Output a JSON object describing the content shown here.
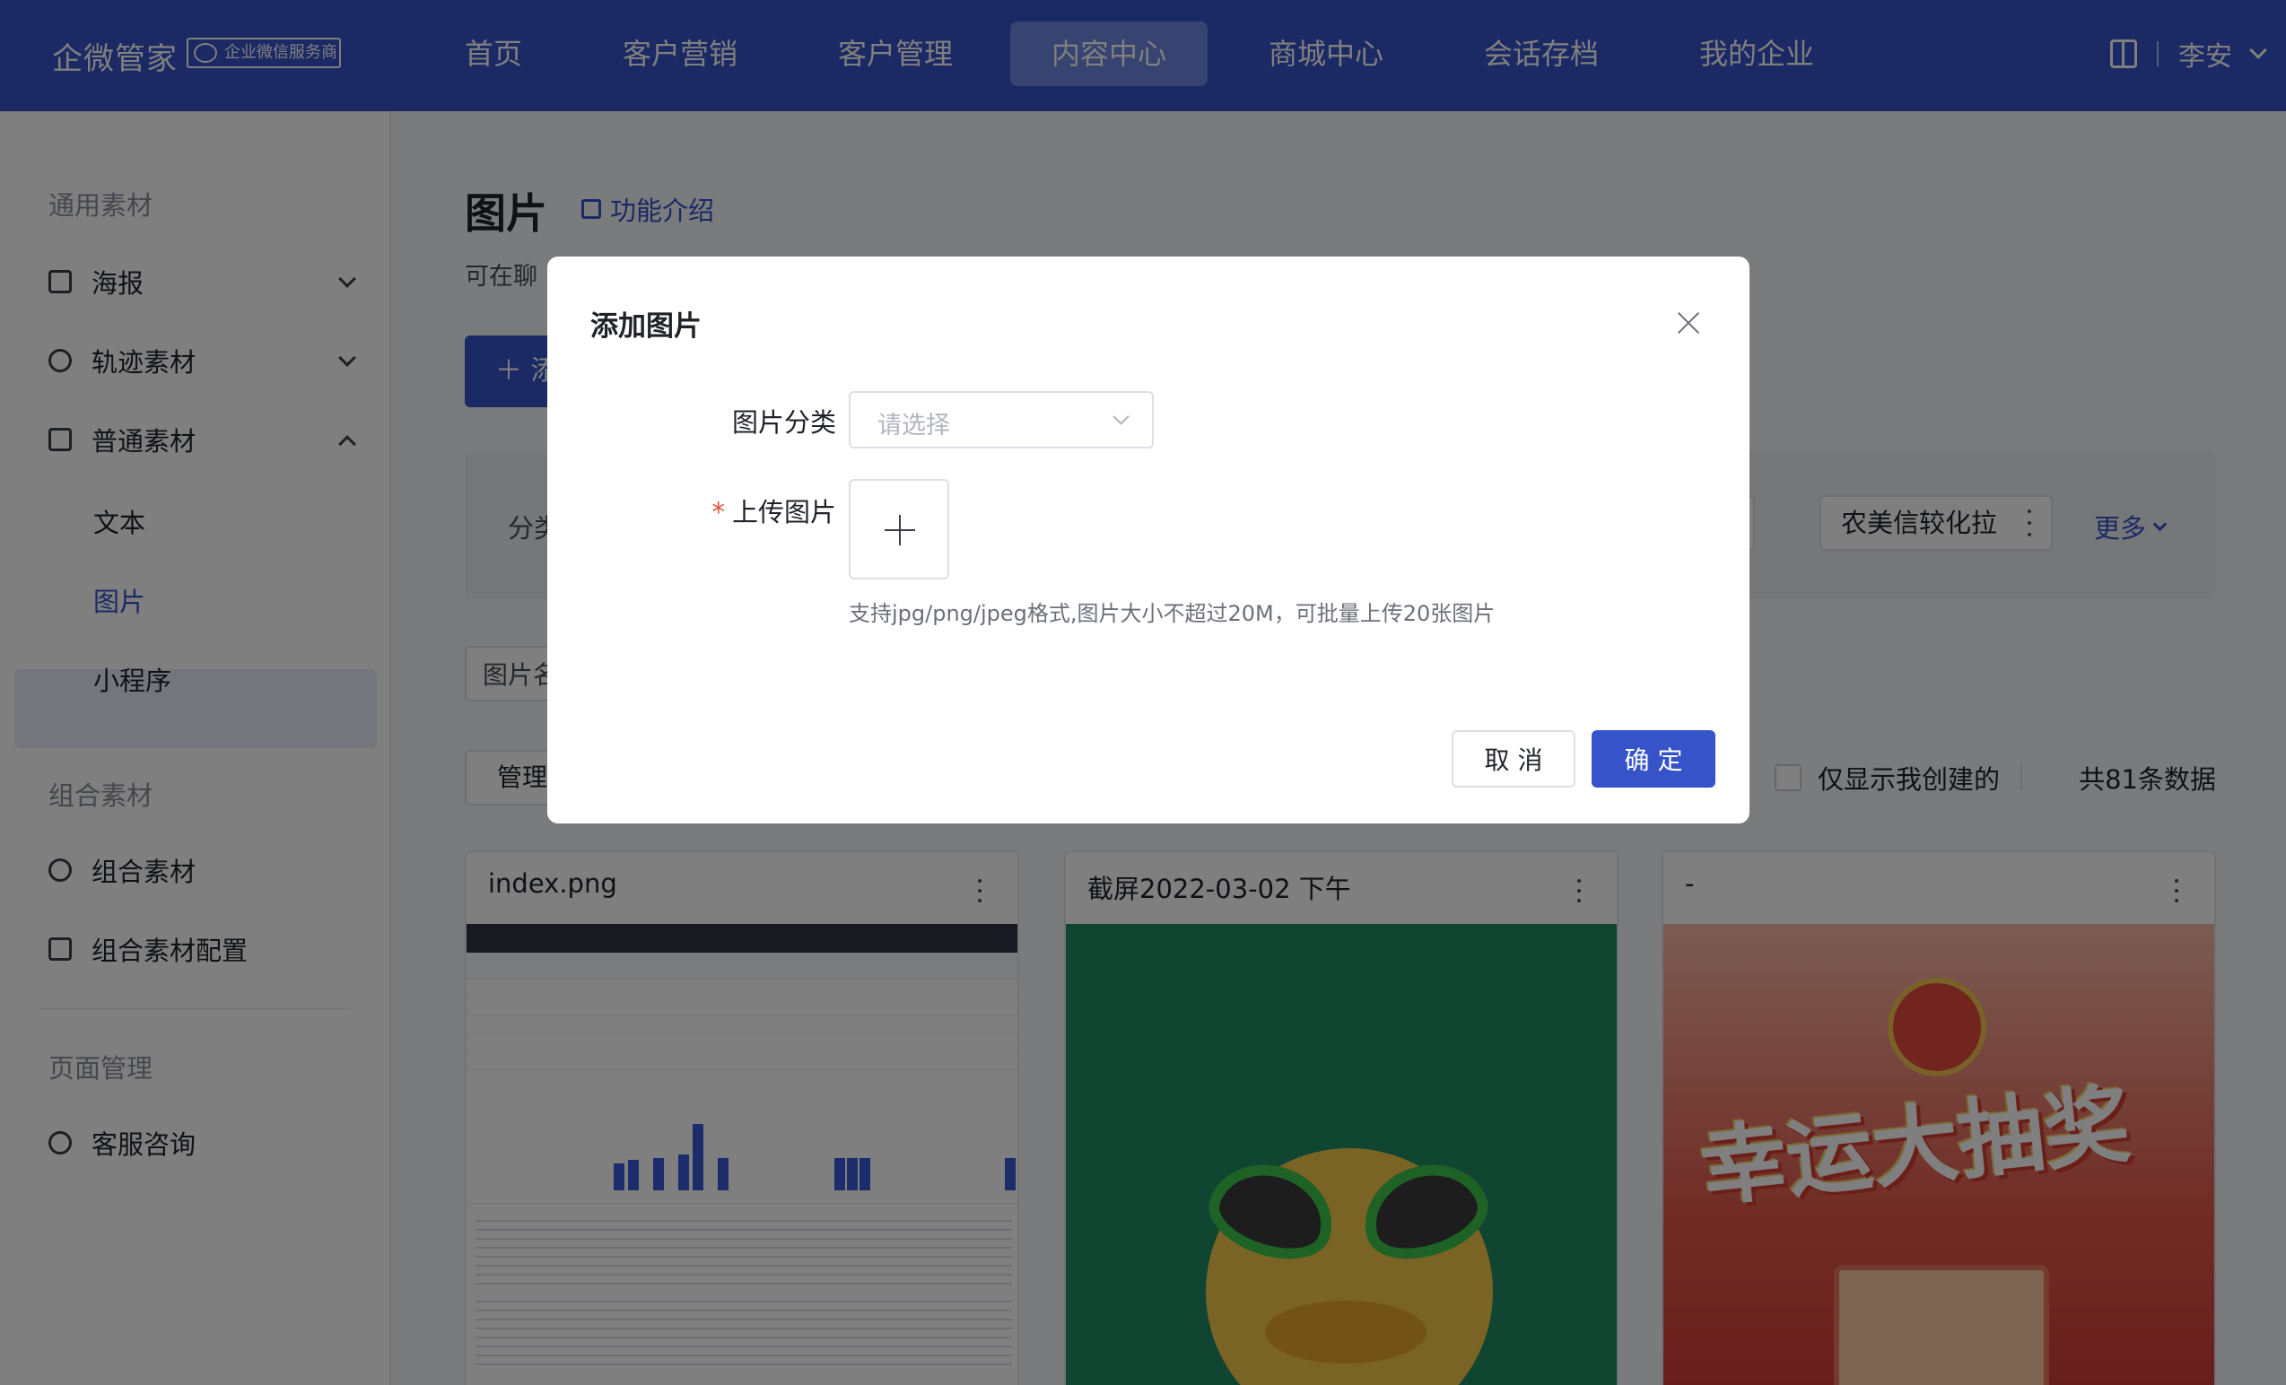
{
  "app": {
    "brand": "企微管家",
    "badge": "企业微信服务商"
  },
  "topnav": {
    "items": [
      "首页",
      "客户营销",
      "客户管理",
      "内容中心",
      "商城中心",
      "会话存档",
      "我的企业"
    ],
    "active": "内容中心",
    "user": "李安",
    "accent_color": "#3653c9"
  },
  "sidebar": {
    "group1": "通用素材",
    "poster": "海报",
    "track": "轨迹素材",
    "normal": "普通素材",
    "sub_text": "文本",
    "sub_image": "图片",
    "sub_miniapp": "小程序",
    "group2": "组合素材",
    "combo": "组合素材",
    "combo_config": "组合素材配置",
    "group3": "页面管理",
    "service": "客服咨询"
  },
  "main": {
    "title": "图片",
    "feature_link": "功能介绍",
    "desc": "可在聊",
    "add_button": "＋ 添",
    "category_label": "分类",
    "category_chip_1": "农美信较化拉",
    "more": "更多",
    "search_placeholder": "图片名",
    "manage_button": "管理",
    "only_mine": "仅显示我创建的",
    "total": "共81条数据"
  },
  "cards": [
    {
      "title": "index.png"
    },
    {
      "title": "截屏2022-03-02 下午"
    },
    {
      "title": "-"
    }
  ],
  "modal": {
    "title": "添加图片",
    "category_label": "图片分类",
    "category_placeholder": "请选择",
    "upload_label": "上传图片",
    "required_mark": "*",
    "hint": "支持jpg/png/jpeg格式,图片大小不超过20M，可批量上传20张图片",
    "cancel": "取 消",
    "confirm": "确 定"
  },
  "lucky_text": "幸运大抽奖"
}
